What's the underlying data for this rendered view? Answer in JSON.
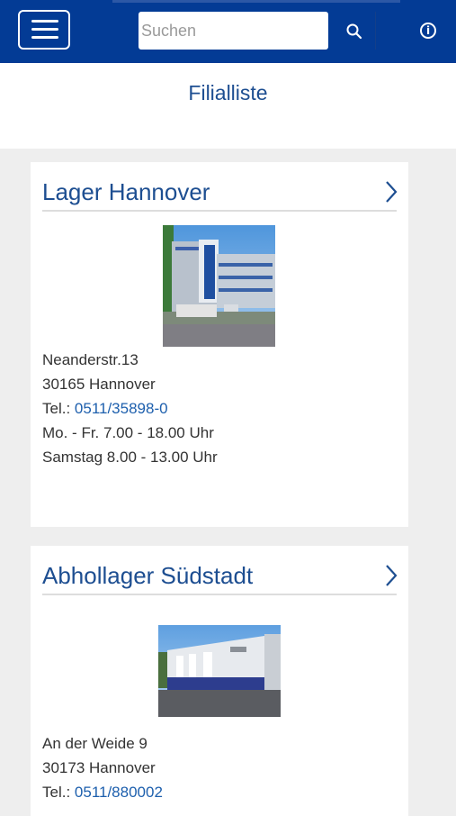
{
  "header": {
    "menu_icon": "hamburger-menu-icon",
    "search_placeholder": "Suchen",
    "search_icon": "search-icon",
    "info_icon": "info-icon",
    "info_glyph": "i",
    "colors": {
      "bar": "#033b95",
      "accent_text": "#1d4e91",
      "link": "#1d5fad"
    }
  },
  "page": {
    "title": "Filialliste"
  },
  "branches": [
    {
      "name": "Lager Hannover",
      "street": "Neanderstr.13",
      "city": "30165 Hannover",
      "phone_label": "Tel.: ",
      "phone": "0511/35898-0",
      "hours": [
        "Mo. - Fr. 7.00 - 18.00 Uhr",
        "Samstag 8.00 - 13.00 Uhr"
      ]
    },
    {
      "name": "Abhollager Südstadt",
      "street": "An der Weide 9",
      "city": "30173 Hannover",
      "phone_label": "Tel.: ",
      "phone": "0511/880002"
    }
  ]
}
